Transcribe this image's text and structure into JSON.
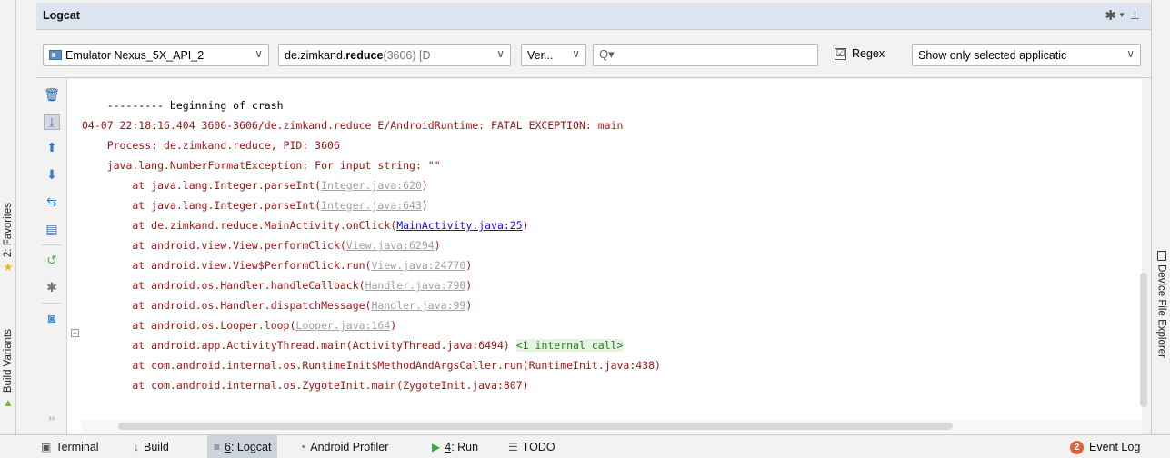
{
  "panel": {
    "title": "Logcat"
  },
  "toolbar": {
    "device": "Emulator Nexus_5X_API_2",
    "process_prefix": "de.zimkand.",
    "process_bold": "reduce",
    "process_suffix": " (3606) [D",
    "level": "Ver...",
    "search_value": "",
    "regex_label": "Regex",
    "regex_checked": "☑",
    "filter": "Show only selected applicatic"
  },
  "left_strip": {
    "favorites": "2: Favorites",
    "build_variants": "Build Variants"
  },
  "right_strip": {
    "device_file_explorer": "Device File Explorer"
  },
  "log": {
    "line0": "    --------- beginning of crash",
    "line1": "04-07 22:18:16.404 3606-3606/de.zimkand.reduce E/AndroidRuntime: FATAL EXCEPTION: main",
    "line2": "    Process: de.zimkand.reduce, PID: 3606",
    "line3": "    java.lang.NumberFormatException: For input string: \"\"",
    "frames": [
      {
        "pre": "        at java.lang.Integer.parseInt(",
        "link": "Integer.java:620",
        "post": ")"
      },
      {
        "pre": "        at java.lang.Integer.parseInt(",
        "link": "Integer.java:643",
        "post": ")"
      },
      {
        "pre": "        at de.zimkand.reduce.MainActivity.onClick(",
        "link": "MainActivity.java:25",
        "post": ")"
      },
      {
        "pre": "        at android.view.View.performClick(",
        "link": "View.java:6294",
        "post": ")"
      },
      {
        "pre": "        at android.view.View$PerformClick.run(",
        "link": "View.java:24770",
        "post": ")"
      },
      {
        "pre": "        at android.os.Handler.handleCallback(",
        "link": "Handler.java:790",
        "post": ")"
      },
      {
        "pre": "        at android.os.Handler.dispatchMessage(",
        "link": "Handler.java:99",
        "post": ")"
      },
      {
        "pre": "        at android.os.Looper.loop(",
        "link": "Looper.java:164",
        "post": ")"
      }
    ],
    "line12": "        at android.app.ActivityThread.main(ActivityThread.java:6494)",
    "line12_internal": "<1 internal call>",
    "line13": "        at com.android.internal.os.RuntimeInit$MethodAndArgsCaller.run(RuntimeInit.java:438)",
    "line14": "        at com.android.internal.os.ZygoteInit.main(ZygoteInit.java:807)"
  },
  "bottom": {
    "terminal": "Terminal",
    "build": "Build",
    "logcat_num": "6",
    "logcat_label": ": Logcat",
    "profiler": "Android Profiler",
    "run_num": "4",
    "run_label": ": Run",
    "todo": "TODO",
    "event_count": "2",
    "event_log": "Event Log"
  },
  "colors": {
    "title_bar": "#dbe4ef",
    "log_text": "#a31515",
    "link_gray": "#a0a0a0",
    "link_blue": "#1a0dff",
    "badge": "#e0623c"
  }
}
